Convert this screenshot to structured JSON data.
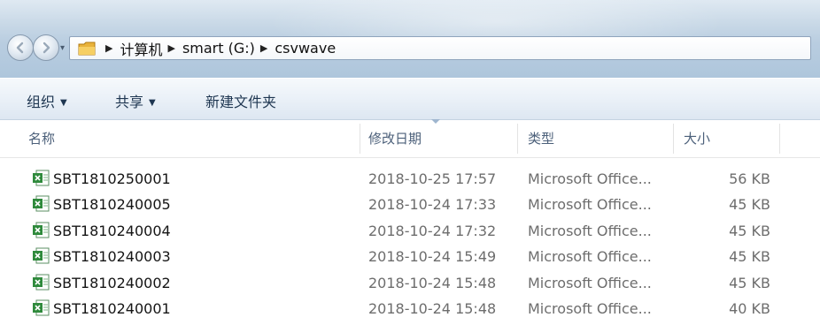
{
  "address": {
    "crumbs": [
      "计算机",
      "smart (G:)",
      "csvwave"
    ]
  },
  "toolbar": {
    "organize_label": "组织",
    "share_label": "共享",
    "new_folder_label": "新建文件夹"
  },
  "columns": {
    "name": "名称",
    "modified": "修改日期",
    "type": "类型",
    "size": "大小"
  },
  "files": [
    {
      "name": "SBT1810250001",
      "modified": "2018-10-25 17:57",
      "type": "Microsoft Office...",
      "size": "56 KB"
    },
    {
      "name": "SBT1810240005",
      "modified": "2018-10-24 17:33",
      "type": "Microsoft Office...",
      "size": "45 KB"
    },
    {
      "name": "SBT1810240004",
      "modified": "2018-10-24 17:32",
      "type": "Microsoft Office...",
      "size": "45 KB"
    },
    {
      "name": "SBT1810240003",
      "modified": "2018-10-24 15:49",
      "type": "Microsoft Office...",
      "size": "45 KB"
    },
    {
      "name": "SBT1810240002",
      "modified": "2018-10-24 15:48",
      "type": "Microsoft Office...",
      "size": "45 KB"
    },
    {
      "name": "SBT1810240001",
      "modified": "2018-10-24 15:48",
      "type": "Microsoft Office...",
      "size": "40 KB"
    }
  ],
  "icons": {
    "file": "excel-file-icon",
    "folder": "folder-icon",
    "back": "back-arrow-icon",
    "forward": "forward-arrow-icon"
  },
  "colors": {
    "accent": "#1e3651",
    "excel_green": "#2f8a3c"
  }
}
